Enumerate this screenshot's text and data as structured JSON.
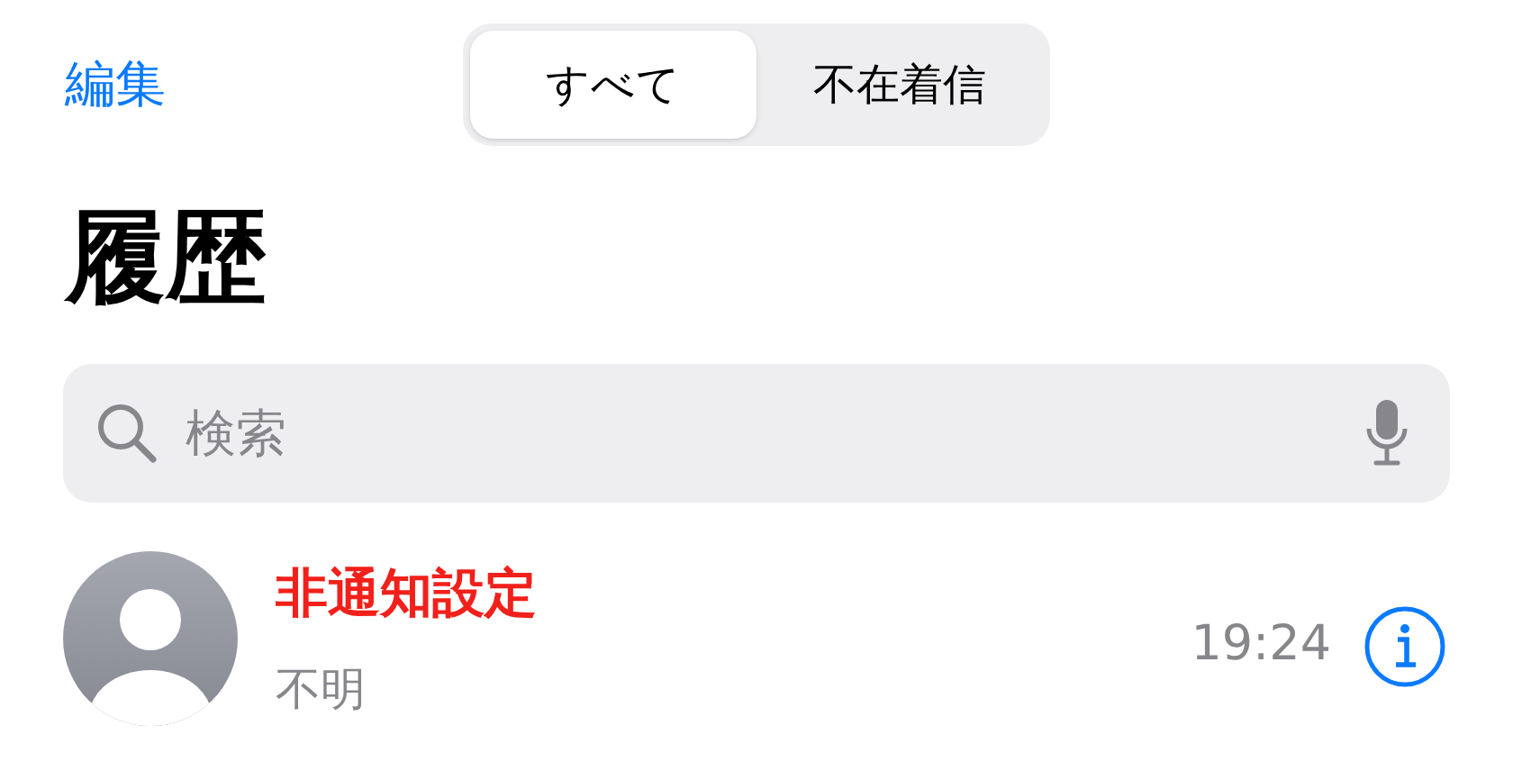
{
  "edit_button": "編集",
  "segments": [
    {
      "label": "すべて",
      "selected": true
    },
    {
      "label": "不在着信",
      "selected": false
    }
  ],
  "title": "履歴",
  "search": {
    "placeholder": "検索"
  },
  "calls": [
    {
      "name": "非通知設定",
      "missed": true,
      "detail": "不明",
      "time": "19:24"
    }
  ]
}
